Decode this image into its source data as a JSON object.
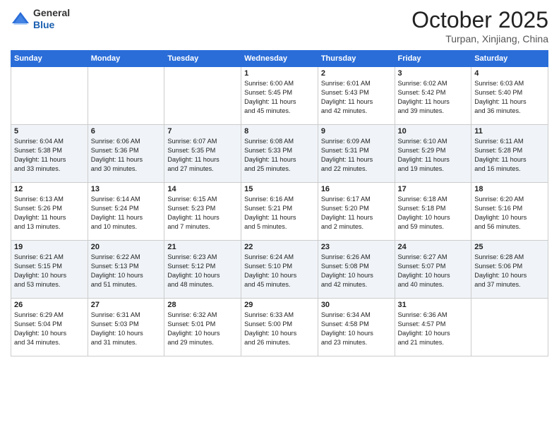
{
  "header": {
    "logo_general": "General",
    "logo_blue": "Blue",
    "month_title": "October 2025",
    "location": "Turpan, Xinjiang, China"
  },
  "days_of_week": [
    "Sunday",
    "Monday",
    "Tuesday",
    "Wednesday",
    "Thursday",
    "Friday",
    "Saturday"
  ],
  "weeks": [
    [
      {
        "day": "",
        "info": ""
      },
      {
        "day": "",
        "info": ""
      },
      {
        "day": "",
        "info": ""
      },
      {
        "day": "1",
        "info": "Sunrise: 6:00 AM\nSunset: 5:45 PM\nDaylight: 11 hours\nand 45 minutes."
      },
      {
        "day": "2",
        "info": "Sunrise: 6:01 AM\nSunset: 5:43 PM\nDaylight: 11 hours\nand 42 minutes."
      },
      {
        "day": "3",
        "info": "Sunrise: 6:02 AM\nSunset: 5:42 PM\nDaylight: 11 hours\nand 39 minutes."
      },
      {
        "day": "4",
        "info": "Sunrise: 6:03 AM\nSunset: 5:40 PM\nDaylight: 11 hours\nand 36 minutes."
      }
    ],
    [
      {
        "day": "5",
        "info": "Sunrise: 6:04 AM\nSunset: 5:38 PM\nDaylight: 11 hours\nand 33 minutes."
      },
      {
        "day": "6",
        "info": "Sunrise: 6:06 AM\nSunset: 5:36 PM\nDaylight: 11 hours\nand 30 minutes."
      },
      {
        "day": "7",
        "info": "Sunrise: 6:07 AM\nSunset: 5:35 PM\nDaylight: 11 hours\nand 27 minutes."
      },
      {
        "day": "8",
        "info": "Sunrise: 6:08 AM\nSunset: 5:33 PM\nDaylight: 11 hours\nand 25 minutes."
      },
      {
        "day": "9",
        "info": "Sunrise: 6:09 AM\nSunset: 5:31 PM\nDaylight: 11 hours\nand 22 minutes."
      },
      {
        "day": "10",
        "info": "Sunrise: 6:10 AM\nSunset: 5:29 PM\nDaylight: 11 hours\nand 19 minutes."
      },
      {
        "day": "11",
        "info": "Sunrise: 6:11 AM\nSunset: 5:28 PM\nDaylight: 11 hours\nand 16 minutes."
      }
    ],
    [
      {
        "day": "12",
        "info": "Sunrise: 6:13 AM\nSunset: 5:26 PM\nDaylight: 11 hours\nand 13 minutes."
      },
      {
        "day": "13",
        "info": "Sunrise: 6:14 AM\nSunset: 5:24 PM\nDaylight: 11 hours\nand 10 minutes."
      },
      {
        "day": "14",
        "info": "Sunrise: 6:15 AM\nSunset: 5:23 PM\nDaylight: 11 hours\nand 7 minutes."
      },
      {
        "day": "15",
        "info": "Sunrise: 6:16 AM\nSunset: 5:21 PM\nDaylight: 11 hours\nand 5 minutes."
      },
      {
        "day": "16",
        "info": "Sunrise: 6:17 AM\nSunset: 5:20 PM\nDaylight: 11 hours\nand 2 minutes."
      },
      {
        "day": "17",
        "info": "Sunrise: 6:18 AM\nSunset: 5:18 PM\nDaylight: 10 hours\nand 59 minutes."
      },
      {
        "day": "18",
        "info": "Sunrise: 6:20 AM\nSunset: 5:16 PM\nDaylight: 10 hours\nand 56 minutes."
      }
    ],
    [
      {
        "day": "19",
        "info": "Sunrise: 6:21 AM\nSunset: 5:15 PM\nDaylight: 10 hours\nand 53 minutes."
      },
      {
        "day": "20",
        "info": "Sunrise: 6:22 AM\nSunset: 5:13 PM\nDaylight: 10 hours\nand 51 minutes."
      },
      {
        "day": "21",
        "info": "Sunrise: 6:23 AM\nSunset: 5:12 PM\nDaylight: 10 hours\nand 48 minutes."
      },
      {
        "day": "22",
        "info": "Sunrise: 6:24 AM\nSunset: 5:10 PM\nDaylight: 10 hours\nand 45 minutes."
      },
      {
        "day": "23",
        "info": "Sunrise: 6:26 AM\nSunset: 5:08 PM\nDaylight: 10 hours\nand 42 minutes."
      },
      {
        "day": "24",
        "info": "Sunrise: 6:27 AM\nSunset: 5:07 PM\nDaylight: 10 hours\nand 40 minutes."
      },
      {
        "day": "25",
        "info": "Sunrise: 6:28 AM\nSunset: 5:06 PM\nDaylight: 10 hours\nand 37 minutes."
      }
    ],
    [
      {
        "day": "26",
        "info": "Sunrise: 6:29 AM\nSunset: 5:04 PM\nDaylight: 10 hours\nand 34 minutes."
      },
      {
        "day": "27",
        "info": "Sunrise: 6:31 AM\nSunset: 5:03 PM\nDaylight: 10 hours\nand 31 minutes."
      },
      {
        "day": "28",
        "info": "Sunrise: 6:32 AM\nSunset: 5:01 PM\nDaylight: 10 hours\nand 29 minutes."
      },
      {
        "day": "29",
        "info": "Sunrise: 6:33 AM\nSunset: 5:00 PM\nDaylight: 10 hours\nand 26 minutes."
      },
      {
        "day": "30",
        "info": "Sunrise: 6:34 AM\nSunset: 4:58 PM\nDaylight: 10 hours\nand 23 minutes."
      },
      {
        "day": "31",
        "info": "Sunrise: 6:36 AM\nSunset: 4:57 PM\nDaylight: 10 hours\nand 21 minutes."
      },
      {
        "day": "",
        "info": ""
      }
    ]
  ]
}
